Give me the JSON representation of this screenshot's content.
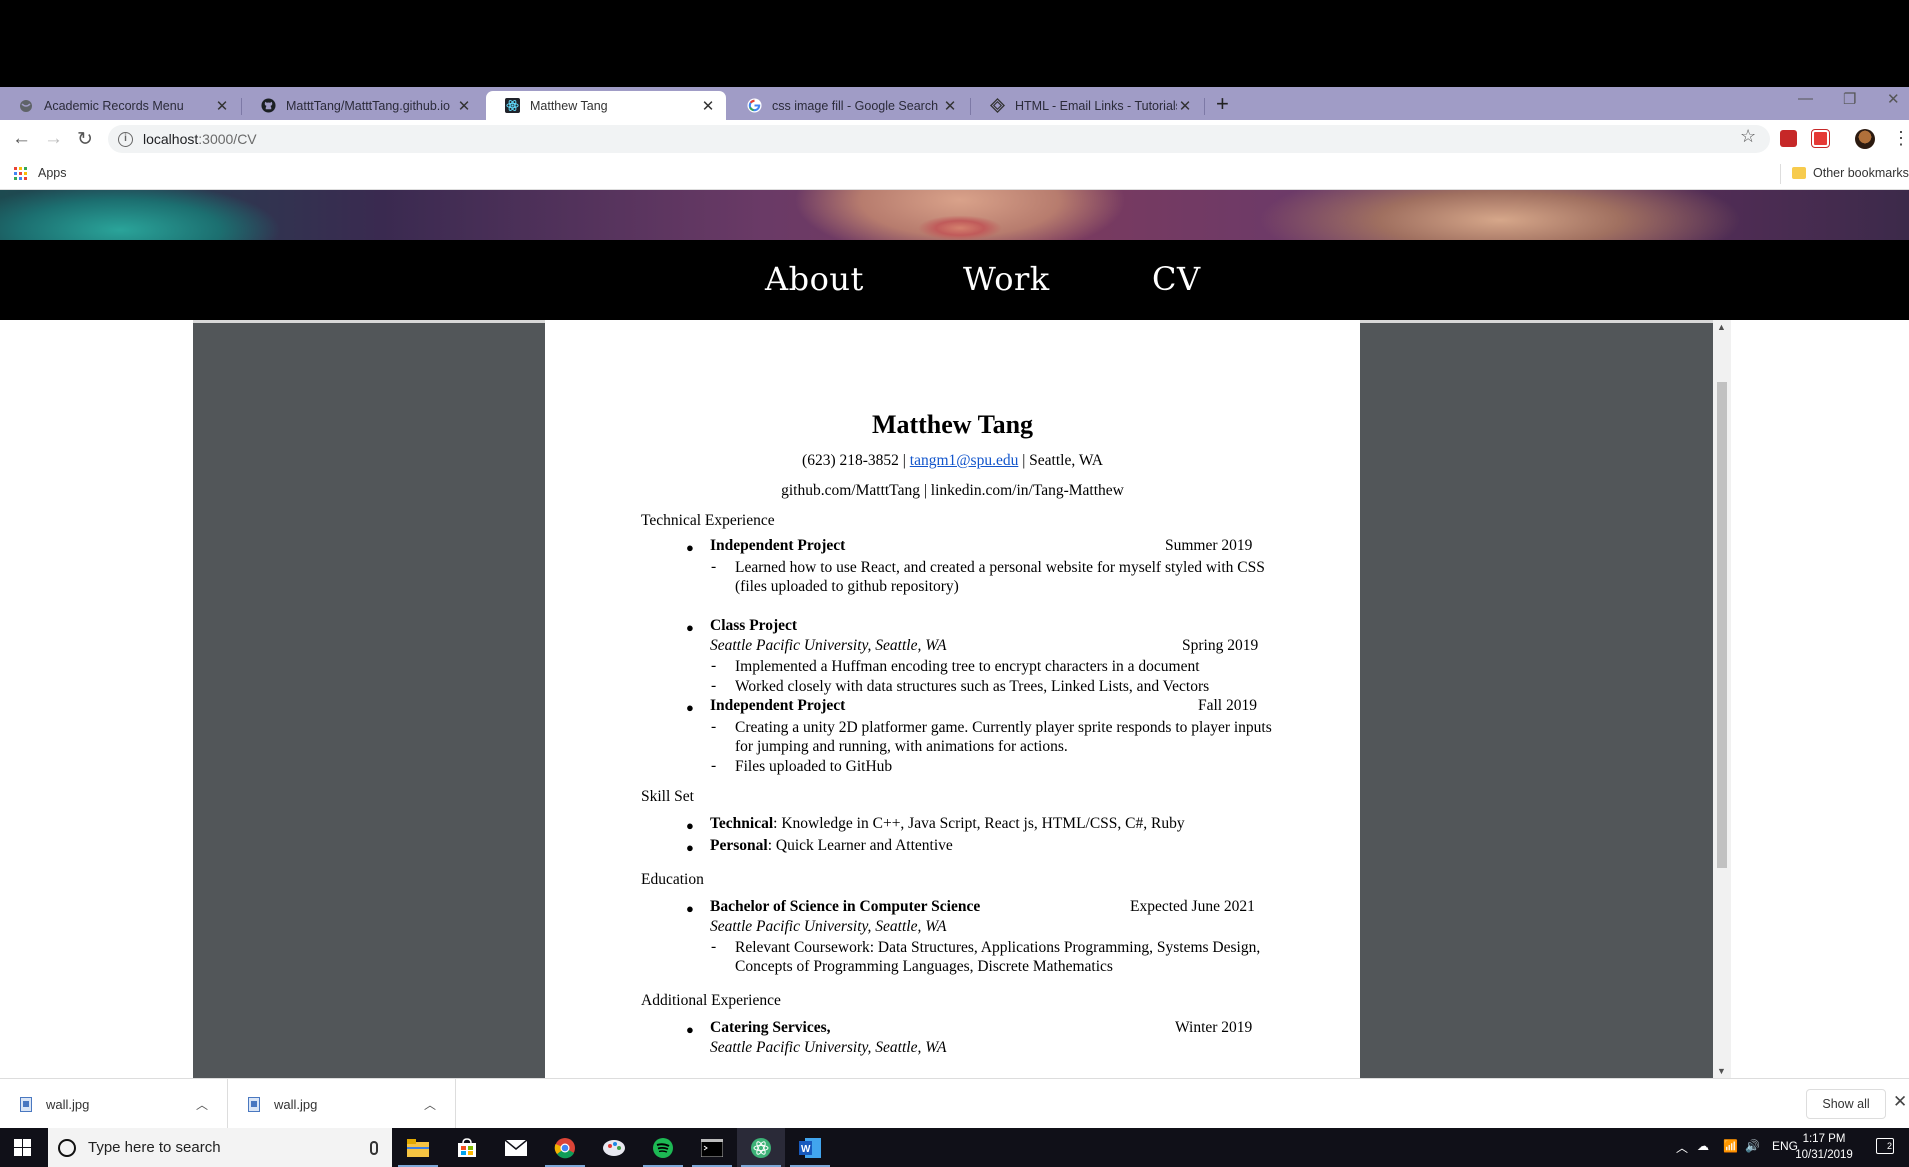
{
  "browser": {
    "tabs": [
      {
        "title": "Academic Records Menu"
      },
      {
        "title": "MatttTang/MatttTang.github.io"
      },
      {
        "title": "Matthew Tang"
      },
      {
        "title": "css image fill - Google Search"
      },
      {
        "title": "HTML - Email Links - Tutorialspoint"
      }
    ],
    "new_tab_symbol": "+",
    "url_host": "localhost",
    "url_path": ":3000/CV",
    "bookmarks": {
      "apps_label": "Apps",
      "other_label": "Other bookmarks"
    }
  },
  "site": {
    "nav": [
      "About",
      "Work",
      "CV"
    ]
  },
  "cv": {
    "name": "Matthew Tang",
    "phone": "(623) 218-3852 | ",
    "email": "tangm1@spu.edu",
    "location": " | Seattle, WA",
    "links": "github.com/MatttTang | linkedin.com/in/Tang-Matthew",
    "bullet_glyph": "●",
    "dash_glyph": "-",
    "sections": {
      "technical": "Technical Experience",
      "skills": "Skill Set",
      "education": "Education",
      "additional": "Additional Experience"
    },
    "tech_items": [
      {
        "title": "Independent Project",
        "date": "Summer 2019",
        "details": [
          "Learned how to use React, and created a personal website for myself styled with CSS (files uploaded to github repository)"
        ]
      },
      {
        "title": "Class Project",
        "subtitle": "Seattle Pacific University, Seattle, WA",
        "date": "Spring 2019",
        "details": [
          "Implemented a Huffman encoding tree to encrypt characters in a document",
          "Worked closely with data structures such as Trees, Linked Lists, and Vectors"
        ]
      },
      {
        "title": "Independent Project",
        "date": "Fall 2019",
        "details": [
          "Creating a unity 2D platformer game. Currently player sprite responds to player inputs for jumping and running, with animations for actions.",
          "Files uploaded to GitHub"
        ]
      }
    ],
    "skills": [
      {
        "label": "Technical",
        "text": ": Knowledge in C++, Java Script, React js, HTML/CSS, C#, Ruby"
      },
      {
        "label": "Personal",
        "text": ": Quick Learner and Attentive"
      }
    ],
    "education": {
      "title": "Bachelor of Science in Computer Science",
      "date": "Expected June 2021",
      "subtitle": "Seattle Pacific University, Seattle, WA",
      "details": [
        "Relevant Coursework: Data Structures, Applications Programming, Systems Design, Concepts of Programming Languages, Discrete Mathematics"
      ]
    },
    "additional": {
      "title": "Catering Services,",
      "date": "Winter 2019",
      "subtitle": "Seattle Pacific University, Seattle, WA"
    }
  },
  "downloads": {
    "items": [
      {
        "name": "wall.jpg"
      },
      {
        "name": "wall.jpg"
      }
    ],
    "show_all": "Show all"
  },
  "taskbar": {
    "search_placeholder": "Type here to search",
    "lang": "ENG",
    "time": "1:17 PM",
    "date": "10/31/2019",
    "notifications": "2"
  },
  "colors": {
    "tabstrip": "#a09cc6",
    "viewer_bg": "#525659",
    "link": "#1155cc",
    "navbar": "#000000"
  }
}
